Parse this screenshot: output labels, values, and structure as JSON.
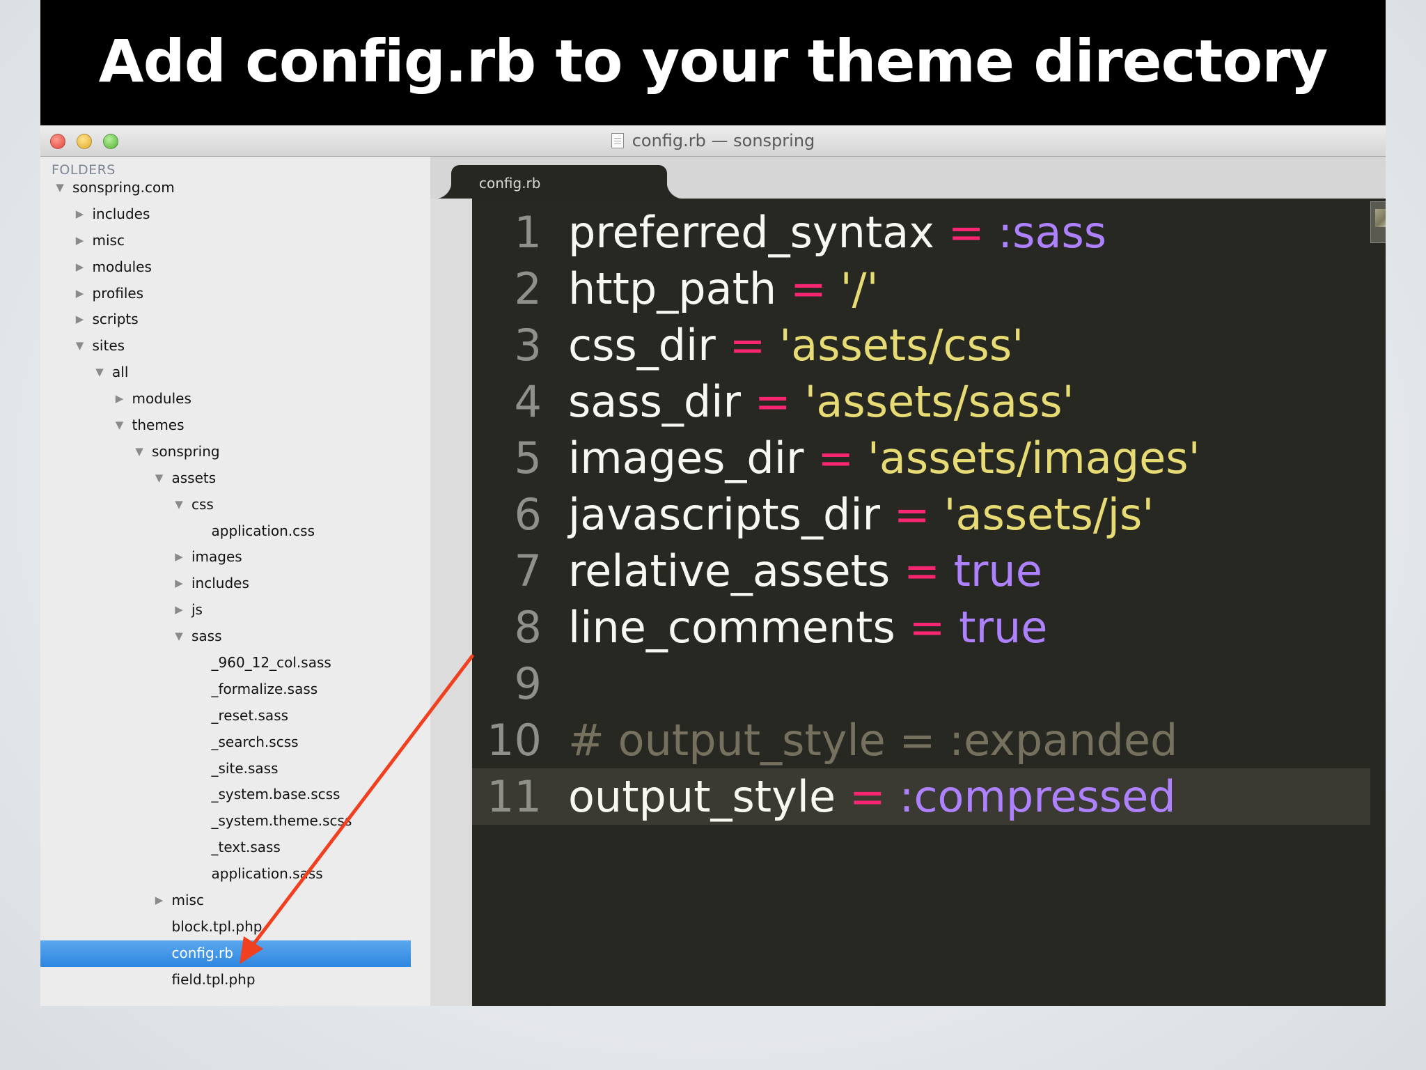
{
  "slide": {
    "title": "Add config.rb to your theme directory"
  },
  "window": {
    "title": "config.rb — sonspring",
    "buttons": [
      "close-button",
      "minimize-button",
      "zoom-button"
    ]
  },
  "sidebar": {
    "header": "FOLDERS",
    "items": [
      {
        "label": "sonspring.com",
        "depth": 0,
        "arrow": "▼"
      },
      {
        "label": "includes",
        "depth": 1,
        "arrow": "▶"
      },
      {
        "label": "misc",
        "depth": 1,
        "arrow": "▶"
      },
      {
        "label": "modules",
        "depth": 1,
        "arrow": "▶"
      },
      {
        "label": "profiles",
        "depth": 1,
        "arrow": "▶"
      },
      {
        "label": "scripts",
        "depth": 1,
        "arrow": "▶"
      },
      {
        "label": "sites",
        "depth": 1,
        "arrow": "▼"
      },
      {
        "label": "all",
        "depth": 2,
        "arrow": "▼"
      },
      {
        "label": "modules",
        "depth": 3,
        "arrow": "▶"
      },
      {
        "label": "themes",
        "depth": 3,
        "arrow": "▼"
      },
      {
        "label": "sonspring",
        "depth": 4,
        "arrow": "▼"
      },
      {
        "label": "assets",
        "depth": 5,
        "arrow": "▼"
      },
      {
        "label": "css",
        "depth": 6,
        "arrow": "▼"
      },
      {
        "label": "application.css",
        "depth": 7,
        "arrow": ""
      },
      {
        "label": "images",
        "depth": 6,
        "arrow": "▶"
      },
      {
        "label": "includes",
        "depth": 6,
        "arrow": "▶"
      },
      {
        "label": "js",
        "depth": 6,
        "arrow": "▶"
      },
      {
        "label": "sass",
        "depth": 6,
        "arrow": "▼"
      },
      {
        "label": "_960_12_col.sass",
        "depth": 7,
        "arrow": ""
      },
      {
        "label": "_formalize.sass",
        "depth": 7,
        "arrow": ""
      },
      {
        "label": "_reset.sass",
        "depth": 7,
        "arrow": ""
      },
      {
        "label": "_search.scss",
        "depth": 7,
        "arrow": ""
      },
      {
        "label": "_site.sass",
        "depth": 7,
        "arrow": ""
      },
      {
        "label": "_system.base.scss",
        "depth": 7,
        "arrow": ""
      },
      {
        "label": "_system.theme.scss",
        "depth": 7,
        "arrow": ""
      },
      {
        "label": "_text.sass",
        "depth": 7,
        "arrow": ""
      },
      {
        "label": "application.sass",
        "depth": 7,
        "arrow": ""
      },
      {
        "label": "misc",
        "depth": 5,
        "arrow": "▶"
      },
      {
        "label": "block.tpl.php",
        "depth": 5,
        "arrow": ""
      },
      {
        "label": "config.rb",
        "depth": 5,
        "arrow": "",
        "selected": true
      },
      {
        "label": "field.tpl.php",
        "depth": 5,
        "arrow": ""
      }
    ]
  },
  "editor": {
    "tab_label": "config.rb",
    "current_line": 11,
    "lines": [
      {
        "n": "1",
        "tokens": [
          {
            "t": "preferred_syntax ",
            "c": "plain"
          },
          {
            "t": "=",
            "c": "op"
          },
          {
            "t": " ",
            "c": "plain"
          },
          {
            "t": ":sass",
            "c": "sym"
          }
        ]
      },
      {
        "n": "2",
        "tokens": [
          {
            "t": "http_path ",
            "c": "plain"
          },
          {
            "t": "=",
            "c": "op"
          },
          {
            "t": " ",
            "c": "plain"
          },
          {
            "t": "'/'",
            "c": "str"
          }
        ]
      },
      {
        "n": "3",
        "tokens": [
          {
            "t": "css_dir ",
            "c": "plain"
          },
          {
            "t": "=",
            "c": "op"
          },
          {
            "t": " ",
            "c": "plain"
          },
          {
            "t": "'assets/css'",
            "c": "str"
          }
        ]
      },
      {
        "n": "4",
        "tokens": [
          {
            "t": "sass_dir ",
            "c": "plain"
          },
          {
            "t": "=",
            "c": "op"
          },
          {
            "t": " ",
            "c": "plain"
          },
          {
            "t": "'assets/sass'",
            "c": "str"
          }
        ]
      },
      {
        "n": "5",
        "tokens": [
          {
            "t": "images_dir ",
            "c": "plain"
          },
          {
            "t": "=",
            "c": "op"
          },
          {
            "t": " ",
            "c": "plain"
          },
          {
            "t": "'assets/images'",
            "c": "str"
          }
        ]
      },
      {
        "n": "6",
        "tokens": [
          {
            "t": "javascripts_dir ",
            "c": "plain"
          },
          {
            "t": "=",
            "c": "op"
          },
          {
            "t": " ",
            "c": "plain"
          },
          {
            "t": "'assets/js'",
            "c": "str"
          }
        ]
      },
      {
        "n": "7",
        "tokens": [
          {
            "t": "relative_assets ",
            "c": "plain"
          },
          {
            "t": "=",
            "c": "op"
          },
          {
            "t": " ",
            "c": "plain"
          },
          {
            "t": "true",
            "c": "bool"
          }
        ]
      },
      {
        "n": "8",
        "tokens": [
          {
            "t": "line_comments ",
            "c": "plain"
          },
          {
            "t": "=",
            "c": "op"
          },
          {
            "t": " ",
            "c": "plain"
          },
          {
            "t": "true",
            "c": "bool"
          }
        ]
      },
      {
        "n": "9",
        "tokens": []
      },
      {
        "n": "10",
        "tokens": [
          {
            "t": "# output_style = :expanded",
            "c": "comment"
          }
        ]
      },
      {
        "n": "11",
        "tokens": [
          {
            "t": "output_style ",
            "c": "plain"
          },
          {
            "t": "=",
            "c": "op"
          },
          {
            "t": " ",
            "c": "plain"
          },
          {
            "t": ":compressed",
            "c": "sym"
          }
        ]
      }
    ]
  },
  "annotation": {
    "type": "arrow",
    "points_to": "config.rb",
    "color": "#f0401f"
  },
  "colors": {
    "editor_bg": "#272822",
    "selection": "#3a8ee6",
    "operator": "#f92672",
    "symbol": "#ae81ff",
    "string": "#e6db74",
    "comment": "#75715e"
  }
}
